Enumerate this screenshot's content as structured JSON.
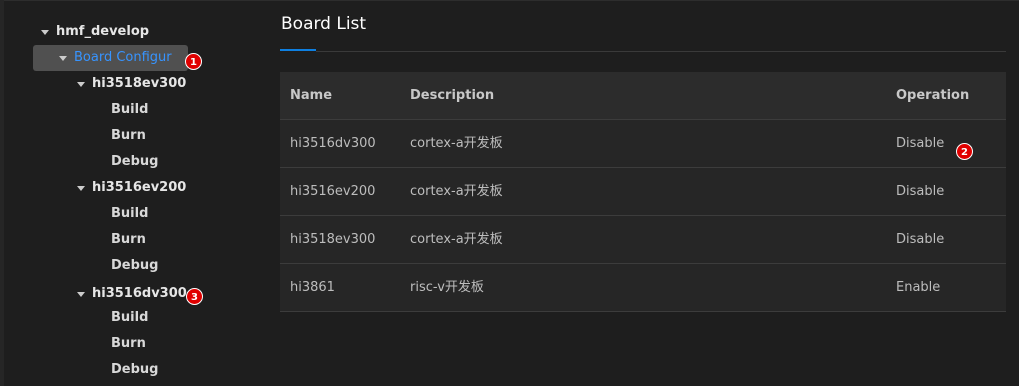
{
  "sidebar": {
    "root": "hmf_develop",
    "board_config": "Board Configur",
    "boards": [
      {
        "name": "hi3518ev300",
        "actions": [
          "Build",
          "Burn",
          "Debug"
        ]
      },
      {
        "name": "hi3516ev200",
        "actions": [
          "Build",
          "Burn",
          "Debug"
        ]
      },
      {
        "name": "hi3516dv300",
        "actions": [
          "Build",
          "Burn",
          "Debug"
        ]
      }
    ]
  },
  "badges": [
    "1",
    "2",
    "3"
  ],
  "main": {
    "title": "Board List",
    "columns": [
      "Name",
      "Description",
      "Operation"
    ],
    "rows": [
      {
        "name": "hi3516dv300",
        "description": "cortex-a开发板",
        "operation": "Disable"
      },
      {
        "name": "hi3516ev200",
        "description": "cortex-a开发板",
        "operation": "Disable"
      },
      {
        "name": "hi3518ev300",
        "description": "cortex-a开发板",
        "operation": "Disable"
      },
      {
        "name": "hi3861",
        "description": "risc-v开发板",
        "operation": "Enable"
      }
    ]
  },
  "colors": {
    "accent": "#3794ff",
    "badge": "#e00000",
    "background": "#1e1e1e"
  },
  "icons": {
    "expand": "chevron-down-icon"
  }
}
